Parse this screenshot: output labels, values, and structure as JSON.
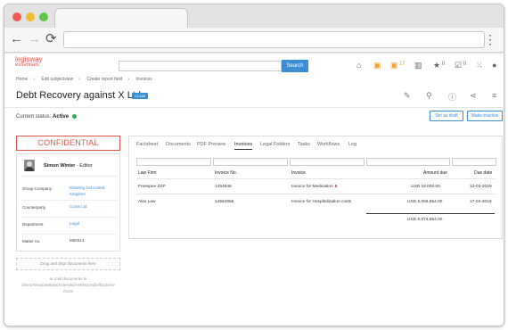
{
  "browser": {
    "nav": {
      "back": "←",
      "forward": "→",
      "reload": "⟳"
    },
    "menu": "⋮"
  },
  "header": {
    "logo_line1": "legisway",
    "logo_line2": "essentials",
    "search_placeholder": "",
    "search_button": "Search",
    "icons": {
      "home": "⌂",
      "flag": "▣",
      "alerts": "▣",
      "alerts_count": "17",
      "book": "▥",
      "star": "★",
      "star_count": "0",
      "check": "☑",
      "check_count": "0",
      "apps": "⁙",
      "user": "●"
    }
  },
  "breadcrumb": [
    "Home",
    "Edit subjectview",
    "Create report field",
    "Invoices"
  ],
  "page": {
    "title": "Debt Recovery against X Ltd",
    "badge": "CLAIM",
    "tool_icons": {
      "edit": "✎",
      "search": "⚲",
      "info": "ⓘ",
      "share": "⋖",
      "menu": "≡"
    },
    "status_label": "Current status:",
    "status_value": "Active",
    "set_draft": "Set as draft",
    "make_inactive": "Make inactive"
  },
  "sidebar": {
    "confidential": "CONFIDENTIAL",
    "user_name": "Simon Winter",
    "user_role": "- Editor",
    "fields": [
      {
        "label": "Group Company",
        "value": "Ebbeling Ltd United Kingdom"
      },
      {
        "label": "Counterparty",
        "value": "Curas Ltd"
      },
      {
        "label": "Department",
        "value": "Legal"
      },
      {
        "label": "Matter no.",
        "value": "M00314"
      }
    ],
    "drop_text": "Drag and drop documents here",
    "mail_text": "or mail documents to DemoTemplateBasicExtended+M00314@efflactome il.com"
  },
  "tabs": [
    "Factsheet",
    "Documents",
    "PDF Preview",
    "Invoices",
    "Legal Folders",
    "Tasks",
    "Workflows",
    "Log"
  ],
  "active_tab": "Invoices",
  "table": {
    "headers": [
      "Law Firm",
      "Invoice No.",
      "Invoice",
      "Amount due",
      "Due date"
    ],
    "rows": [
      {
        "law_firm": "Freespee ZZP",
        "invoice_no": "1454848",
        "invoice": "Invoice for Medication",
        "amount": "USD 18.000.00",
        "due": "13-03-2019"
      },
      {
        "law_firm": "Alex Law",
        "invoice_no": "14564656",
        "invoice": "Invoice for Hospitalization costs",
        "amount": "USD 5.056.854.00",
        "due": "17-04-2019"
      }
    ],
    "total": "USD 5.074.854.00"
  },
  "colors": {
    "accent": "#3b8ed6",
    "brand": "#e2574c",
    "active": "#2eae4d"
  }
}
